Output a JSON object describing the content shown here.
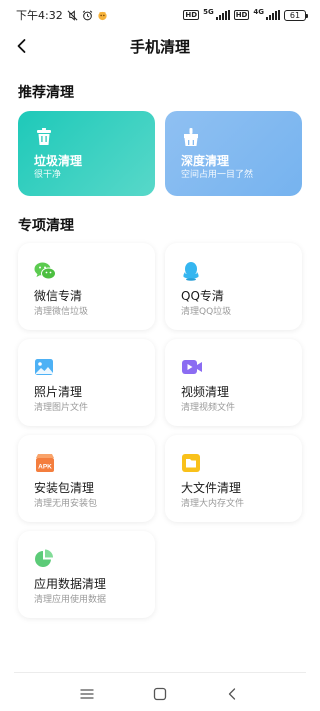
{
  "status_bar": {
    "time": "下午4:32",
    "net1": "5G",
    "net2": "4G",
    "hd1": "HD",
    "hd2": "HD",
    "battery": "61"
  },
  "header": {
    "title": "手机清理"
  },
  "recommended": {
    "section_title": "推荐清理",
    "cards": [
      {
        "title": "垃圾清理",
        "subtitle": "很干净",
        "icon": "trash-icon"
      },
      {
        "title": "深度清理",
        "subtitle": "空间占用一目了然",
        "icon": "broom-icon"
      }
    ]
  },
  "special": {
    "section_title": "专项清理",
    "items": [
      {
        "title": "微信专清",
        "subtitle": "清理微信垃圾",
        "icon": "wechat-icon",
        "color": "#5ccb50"
      },
      {
        "title": "QQ专清",
        "subtitle": "清理QQ垃圾",
        "icon": "qq-icon",
        "color": "#35b6f0"
      },
      {
        "title": "照片清理",
        "subtitle": "清理图片文件",
        "icon": "photo-icon",
        "color": "#4db1f5"
      },
      {
        "title": "视频清理",
        "subtitle": "清理视频文件",
        "icon": "video-icon",
        "color": "#8b6cf2"
      },
      {
        "title": "安装包清理",
        "subtitle": "清理无用安装包",
        "icon": "apk-icon",
        "color": "#f47e3e",
        "icon_text": "APK"
      },
      {
        "title": "大文件清理",
        "subtitle": "清理大内存文件",
        "icon": "folder-icon",
        "color": "#f9c11a"
      },
      {
        "title": "应用数据清理",
        "subtitle": "清理应用使用数据",
        "icon": "pie-chart-icon",
        "color": "#5ccb78"
      }
    ]
  },
  "nav_bar": {
    "buttons": [
      "menu-icon",
      "home-icon",
      "back-icon"
    ]
  }
}
